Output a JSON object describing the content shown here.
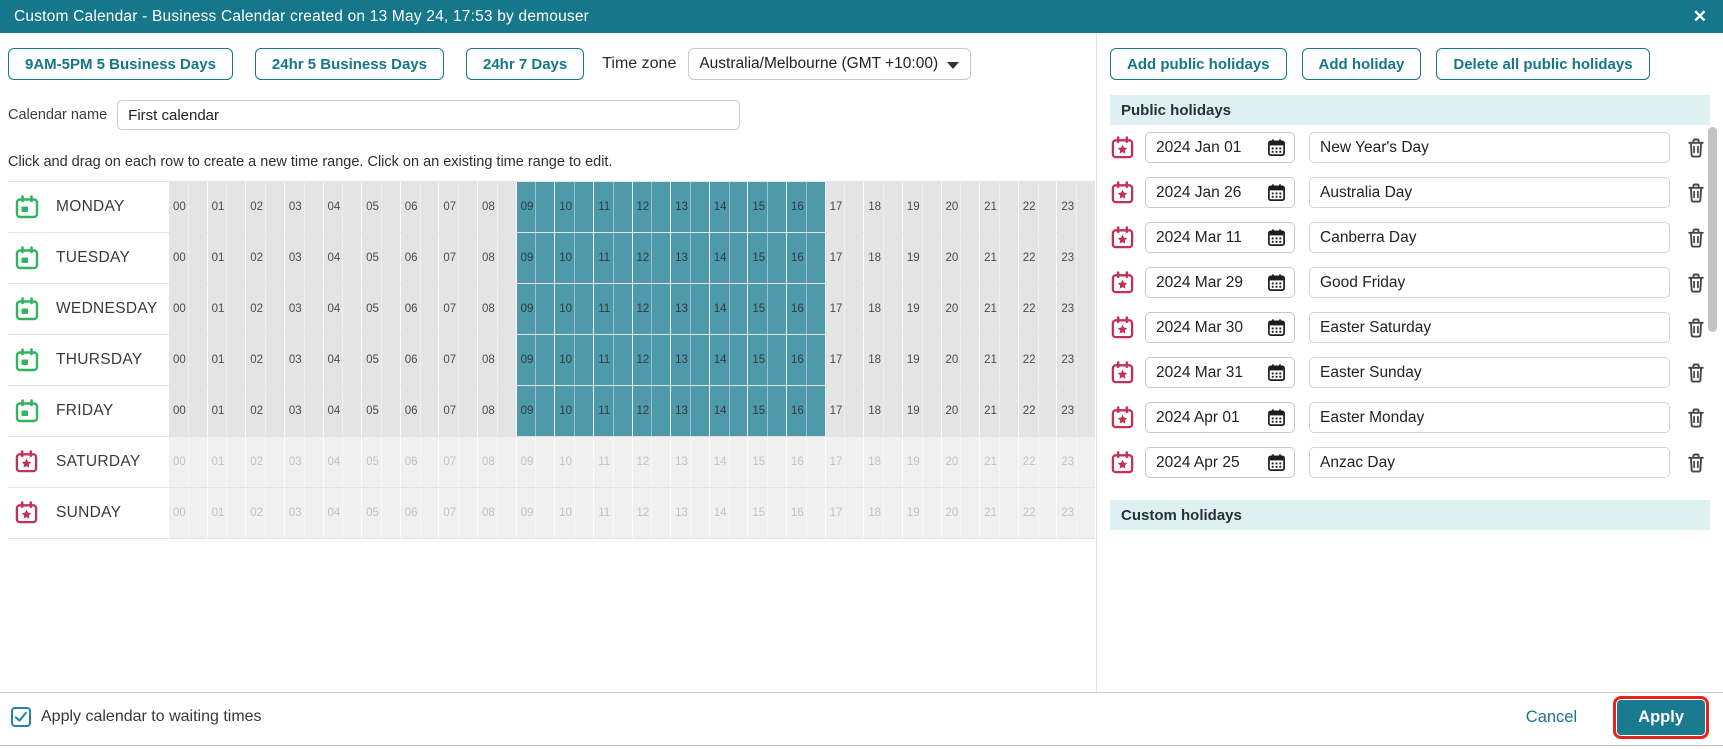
{
  "titlebar": {
    "title": "Custom Calendar - Business Calendar created on 13 May 24, 17:53 by demouser",
    "close_glyph": "✕"
  },
  "toolbar": {
    "presets": [
      "9AM-5PM 5 Business Days",
      "24hr 5 Business Days",
      "24hr 7 Days"
    ],
    "timezone_label": "Time zone",
    "timezone_value": "Australia/Melbourne (GMT +10:00)"
  },
  "calendar_name": {
    "label": "Calendar name",
    "value": "First calendar"
  },
  "hint": "Click and drag on each row to create a new time range. Click on an existing time range to edit.",
  "week_grid": {
    "hours": [
      "00",
      "01",
      "02",
      "03",
      "04",
      "05",
      "06",
      "07",
      "08",
      "09",
      "10",
      "11",
      "12",
      "13",
      "14",
      "15",
      "16",
      "17",
      "18",
      "19",
      "20",
      "21",
      "22",
      "23"
    ],
    "days": [
      {
        "name": "MONDAY",
        "type": "business",
        "selected_range": [
          9,
          17
        ]
      },
      {
        "name": "TUESDAY",
        "type": "business",
        "selected_range": [
          9,
          17
        ]
      },
      {
        "name": "WEDNESDAY",
        "type": "business",
        "selected_range": [
          9,
          17
        ]
      },
      {
        "name": "THURSDAY",
        "type": "business",
        "selected_range": [
          9,
          17
        ]
      },
      {
        "name": "FRIDAY",
        "type": "business",
        "selected_range": [
          9,
          17
        ]
      },
      {
        "name": "SATURDAY",
        "type": "weekend",
        "selected_range": null
      },
      {
        "name": "SUNDAY",
        "type": "weekend",
        "selected_range": null
      }
    ]
  },
  "holiday_toolbar": {
    "add_public": "Add public holidays",
    "add_holiday": "Add holiday",
    "delete_all": "Delete all public holidays"
  },
  "public_holidays": {
    "header": "Public holidays",
    "rows": [
      {
        "date": "2024 Jan 01",
        "name": "New Year's Day"
      },
      {
        "date": "2024 Jan 26",
        "name": "Australia Day"
      },
      {
        "date": "2024 Mar 11",
        "name": "Canberra Day"
      },
      {
        "date": "2024 Mar 29",
        "name": "Good Friday"
      },
      {
        "date": "2024 Mar 30",
        "name": "Easter Saturday"
      },
      {
        "date": "2024 Mar 31",
        "name": "Easter Sunday"
      },
      {
        "date": "2024 Apr 01",
        "name": "Easter Monday"
      },
      {
        "date": "2024 Apr 25",
        "name": "Anzac Day"
      }
    ]
  },
  "custom_holidays": {
    "header": "Custom holidays"
  },
  "footer": {
    "checkbox_label": "Apply calendar to waiting times",
    "checkbox_checked": true,
    "cancel_label": "Cancel",
    "apply_label": "Apply"
  },
  "colors": {
    "header_teal": "#16768a",
    "accent_teal": "#17768b",
    "selected_cell_teal": "#4f9aaa",
    "section_band_cyan": "#dff0f2",
    "business_icon_green": "#2fb560",
    "holiday_icon_red": "#c43156",
    "apply_focus_ring_red": "#e6231c"
  }
}
